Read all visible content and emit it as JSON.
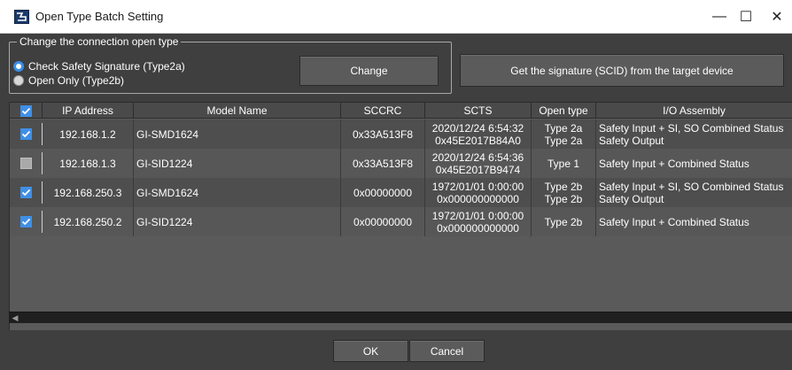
{
  "window": {
    "title": "Open Type Batch Setting",
    "controls": {
      "minimize": "—",
      "maximize": "☐",
      "close": "✕"
    }
  },
  "connection_group": {
    "legend": "Change the connection open type",
    "options": [
      {
        "label": "Check Safety Signature (Type2a)",
        "selected": true
      },
      {
        "label": "Open Only (Type2b)",
        "selected": false
      }
    ],
    "change_button": "Change",
    "get_signature_button": "Get the signature (SCID) from the target device"
  },
  "table": {
    "columns": [
      "IP Address",
      "Model Name",
      "SCCRC",
      "SCTS",
      "Open type",
      "I/O Assembly"
    ],
    "rows": [
      {
        "checked": true,
        "ip": "192.168.1.2",
        "model": "GI-SMD1624",
        "sccrc": "0x33A513F8",
        "scts": [
          "2020/12/24 6:54:32",
          "0x45E2017B84A0"
        ],
        "open_type": [
          "Type 2a",
          "Type 2a"
        ],
        "io_assembly": [
          "Safety Input + SI, SO Combined Status",
          "Safety Output"
        ]
      },
      {
        "checked": false,
        "ip": "192.168.1.3",
        "model": "GI-SID1224",
        "sccrc": "0x33A513F8",
        "scts": [
          "2020/12/24 6:54:36",
          "0x45E2017B9474"
        ],
        "open_type": [
          "Type 1"
        ],
        "io_assembly": [
          "Safety Input + Combined Status"
        ]
      },
      {
        "checked": true,
        "ip": "192.168.250.3",
        "model": "GI-SMD1624",
        "sccrc": "0x00000000",
        "scts": [
          "1972/01/01 0:00:00",
          "0x000000000000"
        ],
        "open_type": [
          "Type 2b",
          "Type 2b"
        ],
        "io_assembly": [
          "Safety Input + SI, SO Combined Status",
          "Safety Output"
        ]
      },
      {
        "checked": true,
        "ip": "192.168.250.2",
        "model": "GI-SID1224",
        "sccrc": "0x00000000",
        "scts": [
          "1972/01/01 0:00:00",
          "0x000000000000"
        ],
        "open_type": [
          "Type 2b"
        ],
        "io_assembly": [
          "Safety Input + Combined Status"
        ]
      }
    ]
  },
  "footer": {
    "ok_button": "OK",
    "cancel_button": "Cancel"
  },
  "colors": {
    "background": "#3f3f3f",
    "accent_blue": "#3f8fe6"
  }
}
